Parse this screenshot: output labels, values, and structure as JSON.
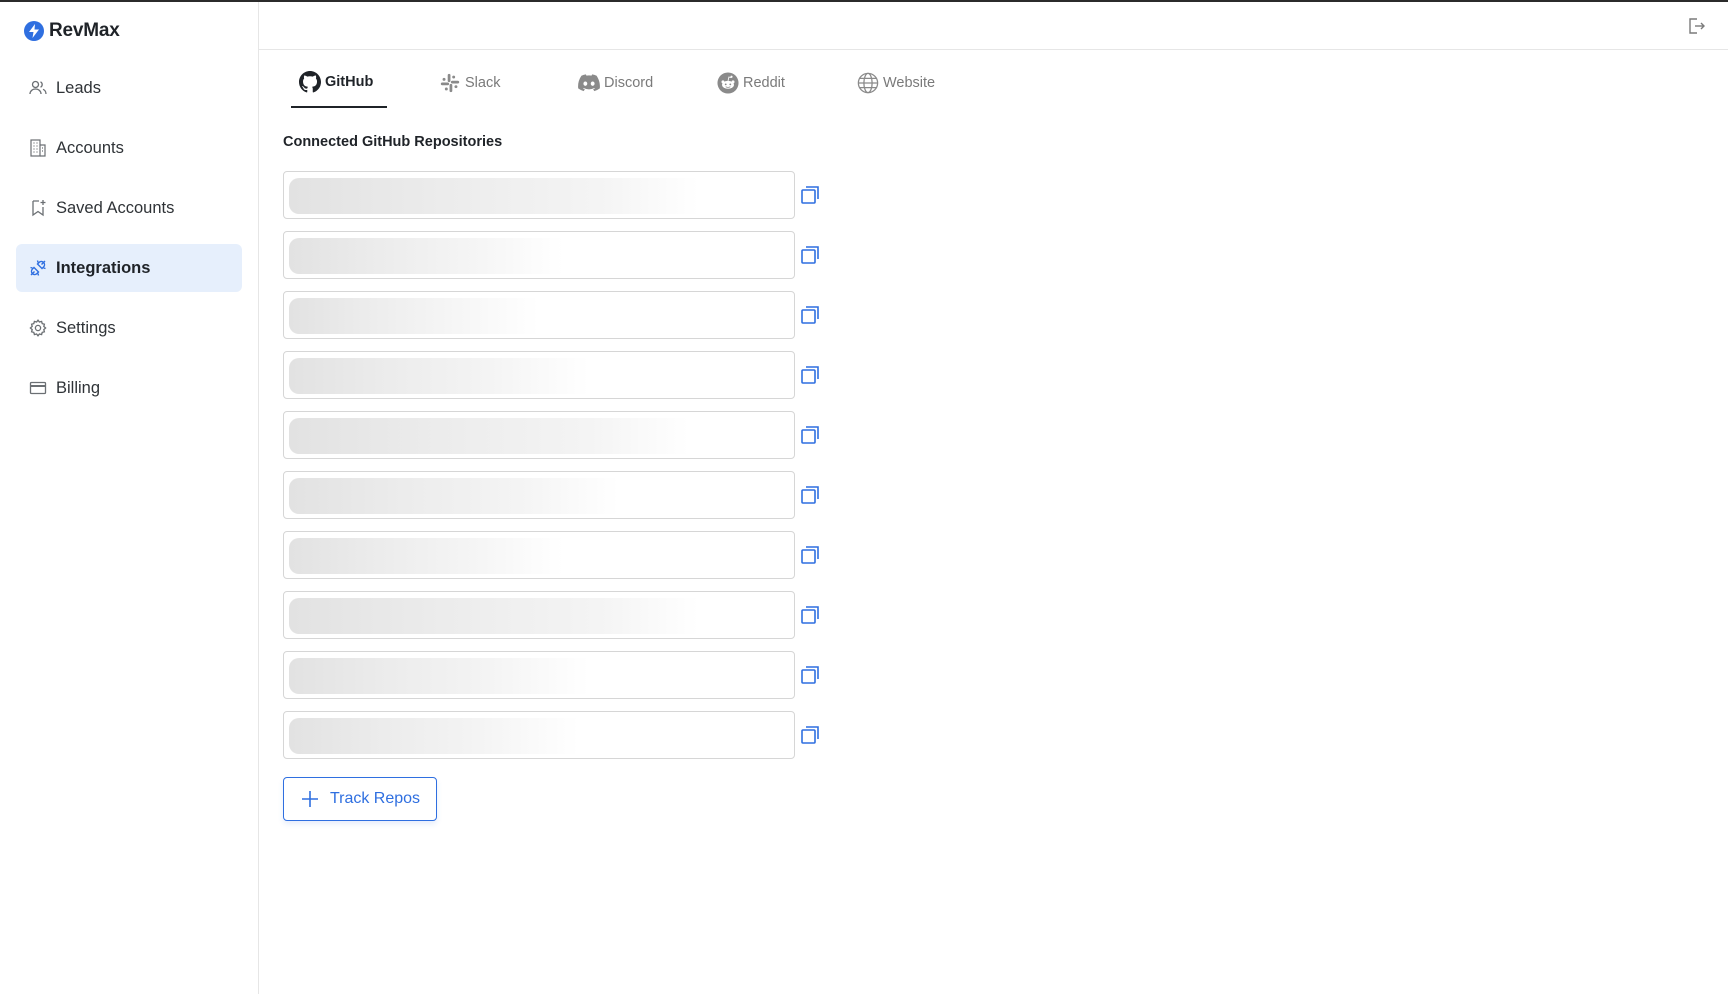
{
  "app": {
    "name": "RevMax"
  },
  "sidebar": {
    "items": [
      {
        "label": "Leads",
        "icon": "users-icon",
        "active": false
      },
      {
        "label": "Accounts",
        "icon": "building-icon",
        "active": false
      },
      {
        "label": "Saved Accounts",
        "icon": "bookmark-plus-icon",
        "active": false
      },
      {
        "label": "Integrations",
        "icon": "plug-icon",
        "active": true
      },
      {
        "label": "Settings",
        "icon": "gear-icon",
        "active": false
      },
      {
        "label": "Billing",
        "icon": "credit-card-icon",
        "active": false
      }
    ]
  },
  "header": {
    "logout_icon": "logout-icon"
  },
  "tabs": [
    {
      "label": "GitHub",
      "icon": "github-icon",
      "active": true
    },
    {
      "label": "Slack",
      "icon": "slack-icon",
      "active": false
    },
    {
      "label": "Discord",
      "icon": "discord-icon",
      "active": false
    },
    {
      "label": "Reddit",
      "icon": "reddit-icon",
      "active": false
    },
    {
      "label": "Website",
      "icon": "globe-icon",
      "active": false
    }
  ],
  "main": {
    "section_title": "Connected GitHub Repositories",
    "repo_count": 10,
    "repo_state": "loading",
    "track_button_label": "Track Repos"
  },
  "colors": {
    "accent": "#2f6fe0",
    "active_nav_bg": "#e6effc",
    "skeleton": "#e4e4e4"
  }
}
